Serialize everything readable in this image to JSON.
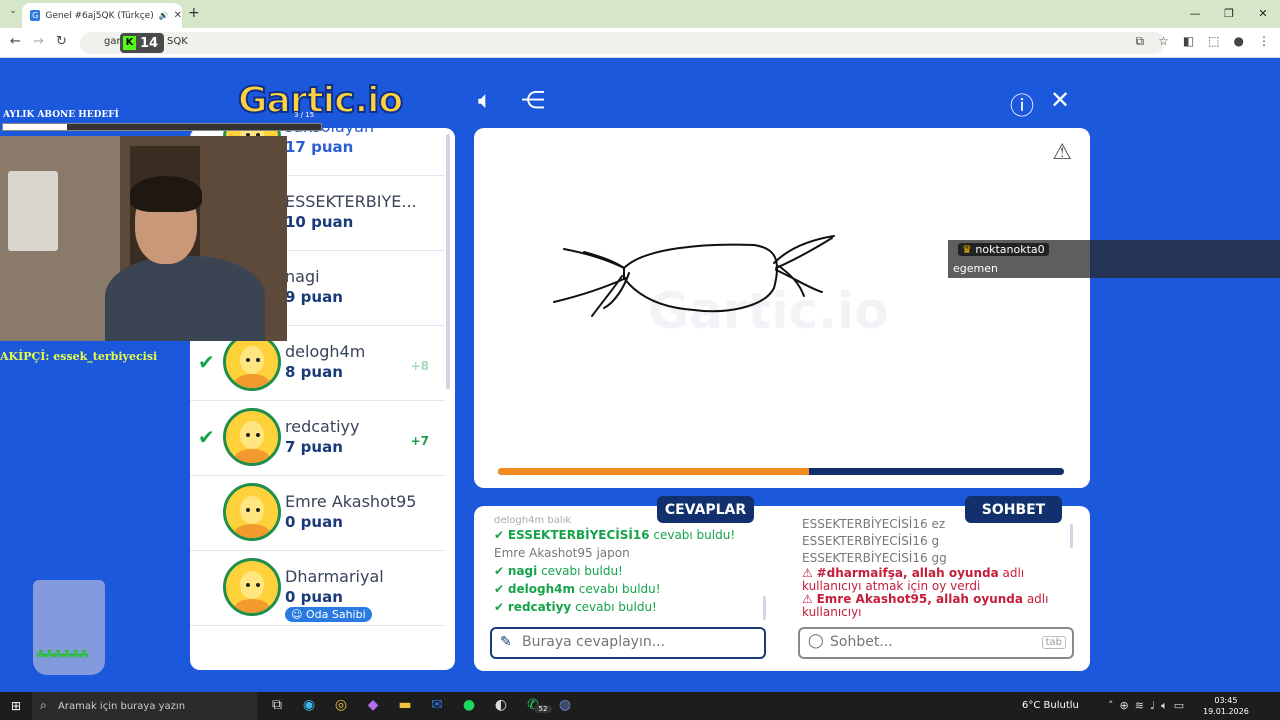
{
  "browser": {
    "tab_title": "Genel #6aj5QK (Türkçe) - G",
    "tab_favicon": "G",
    "url_partial": "gar",
    "url_suffix": "SQK",
    "kick_count": "14"
  },
  "overlay": {
    "goal_label": "AYLIK ABONE HEDEFİ",
    "goal_count": "3 / 15",
    "goal_progress": 0.2,
    "follower_text": "AKİPÇİ: essek_terbiyecisi"
  },
  "logo_text": "Gartic.io",
  "players": [
    {
      "name": "saksolayan",
      "points": "17 puan",
      "guessed": false,
      "delta": "",
      "highlight": true
    },
    {
      "name": "ESSEKTERBIYE...",
      "points": "10 puan",
      "guessed": false,
      "delta": ""
    },
    {
      "name": "nagi",
      "points": "9 puan",
      "guessed": false,
      "delta": ""
    },
    {
      "name": "delogh4m",
      "points": "8 puan",
      "guessed": true,
      "delta": "+8"
    },
    {
      "name": "redcatiyy",
      "points": "7 puan",
      "guessed": true,
      "delta": "+7"
    },
    {
      "name": "Emre Akashot95",
      "points": "0 puan",
      "guessed": false,
      "delta": ""
    },
    {
      "name": "Dharmariyal",
      "points": "0 puan",
      "guessed": false,
      "delta": "",
      "badge": "Oda Sahibi"
    }
  ],
  "canvas": {
    "round_progress": 0.55,
    "guess_user": "noktanokta0",
    "guess_message": "egemen"
  },
  "answers": {
    "header": "CEVAPLAR",
    "rows": [
      {
        "type": "dim",
        "text": "delogh4m balık"
      },
      {
        "type": "ok",
        "user": "ESSEKTERBİYECİSİ16",
        "text": "cevabı buldu!"
      },
      {
        "type": "plain",
        "user": "Emre Akashot95",
        "text": "japon"
      },
      {
        "type": "ok",
        "user": "nagi",
        "text": "cevabı buldu!"
      },
      {
        "type": "ok",
        "user": "delogh4m",
        "text": "cevabı buldu!"
      },
      {
        "type": "ok",
        "user": "redcatiyy",
        "text": "cevabı buldu!"
      }
    ],
    "placeholder": "Buraya cevaplayın..."
  },
  "chat": {
    "header": "SOHBET",
    "rows": [
      {
        "type": "plain",
        "user": "ESSEKTERBİYECİSİ16",
        "text": "ez"
      },
      {
        "type": "plain",
        "user": "ESSEKTERBİYECİSİ16",
        "text": "g"
      },
      {
        "type": "plain",
        "user": "ESSEKTERBİYECİSİ16",
        "text": "gg"
      },
      {
        "type": "alert",
        "user": "#dharmaifşa, allah oyunda",
        "text": "adlı kullanıcıyı atmak için oy verdi"
      },
      {
        "type": "alert",
        "user": "Emre Akashot95, allah oyunda",
        "text": "adlı kullanıcıyı"
      }
    ],
    "placeholder": "Sohbet...",
    "tab_key": "tab"
  },
  "taskbar": {
    "search_placeholder": "Aramak için buraya yazın",
    "whatsapp_badge": "52",
    "weather": "6°C  Bulutlu",
    "time": "03:45",
    "date": "19.01.2026"
  }
}
